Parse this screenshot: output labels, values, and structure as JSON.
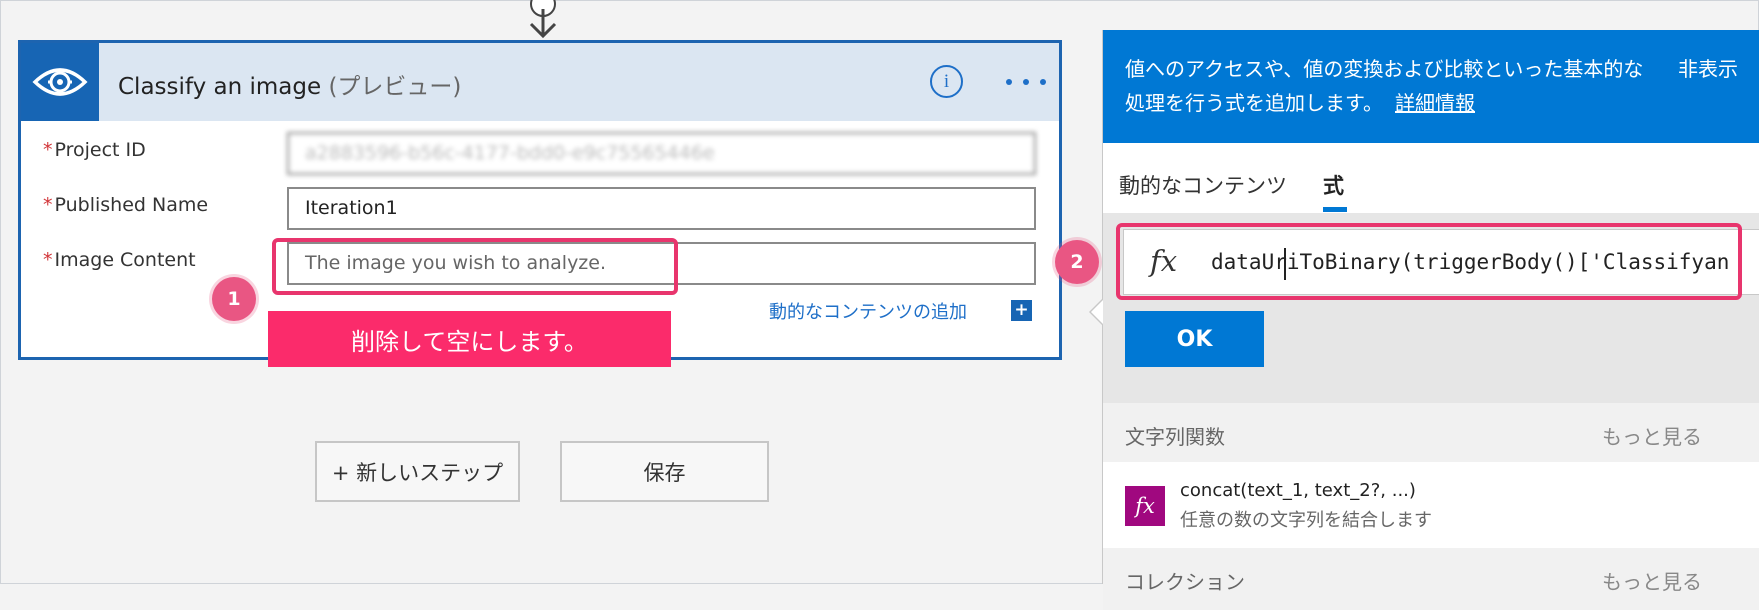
{
  "action_card": {
    "title": "Classify an image",
    "title_suffix": "(プレビュー)",
    "info_icon": "info-icon",
    "more_icon": "ellipsis-icon",
    "fields": [
      {
        "label": "Project ID",
        "value": "a2883596-b56c-4177-bdd0-e9c75565446e",
        "blurred": true
      },
      {
        "label": "Published Name",
        "value": "Iteration1"
      },
      {
        "label": "Image Content",
        "placeholder": "The image you wish to analyze."
      }
    ],
    "dynamic_content_link": "動的なコンテンツの追加",
    "plus_icon": "+"
  },
  "annotations": {
    "badge_1": "1",
    "badge_2": "2",
    "callout_text": "削除して空にします。",
    "highlight_color": "#e8356d"
  },
  "buttons": {
    "new_step": "+ 新しいステップ",
    "save": "保存"
  },
  "expression_pane": {
    "description": "値へのアクセスや、値の変換および比較といった基本的な処理を行う式を追加します。",
    "learn_more": "詳細情報",
    "hide": "非表示",
    "tabs": [
      "動的なコンテンツ",
      "式"
    ],
    "active_tab": "式",
    "fx_symbol": "fx",
    "expression": "dataUriToBinary(triggerBody()['Classifyan",
    "ok_label": "OK",
    "sections": [
      {
        "title": "文字列関数",
        "more": "もっと見る"
      },
      {
        "title": "コレクション",
        "more": "もっと見る"
      }
    ],
    "functions": [
      {
        "name": "concat(text_1, text_2?, ...)",
        "description": "任意の数の文字列を結合します",
        "icon": "fx"
      }
    ]
  },
  "colors": {
    "accent": "#0078d4",
    "card_border": "#1d64b0",
    "callout": "#fb2b6b",
    "function_icon": "#a0087f"
  }
}
